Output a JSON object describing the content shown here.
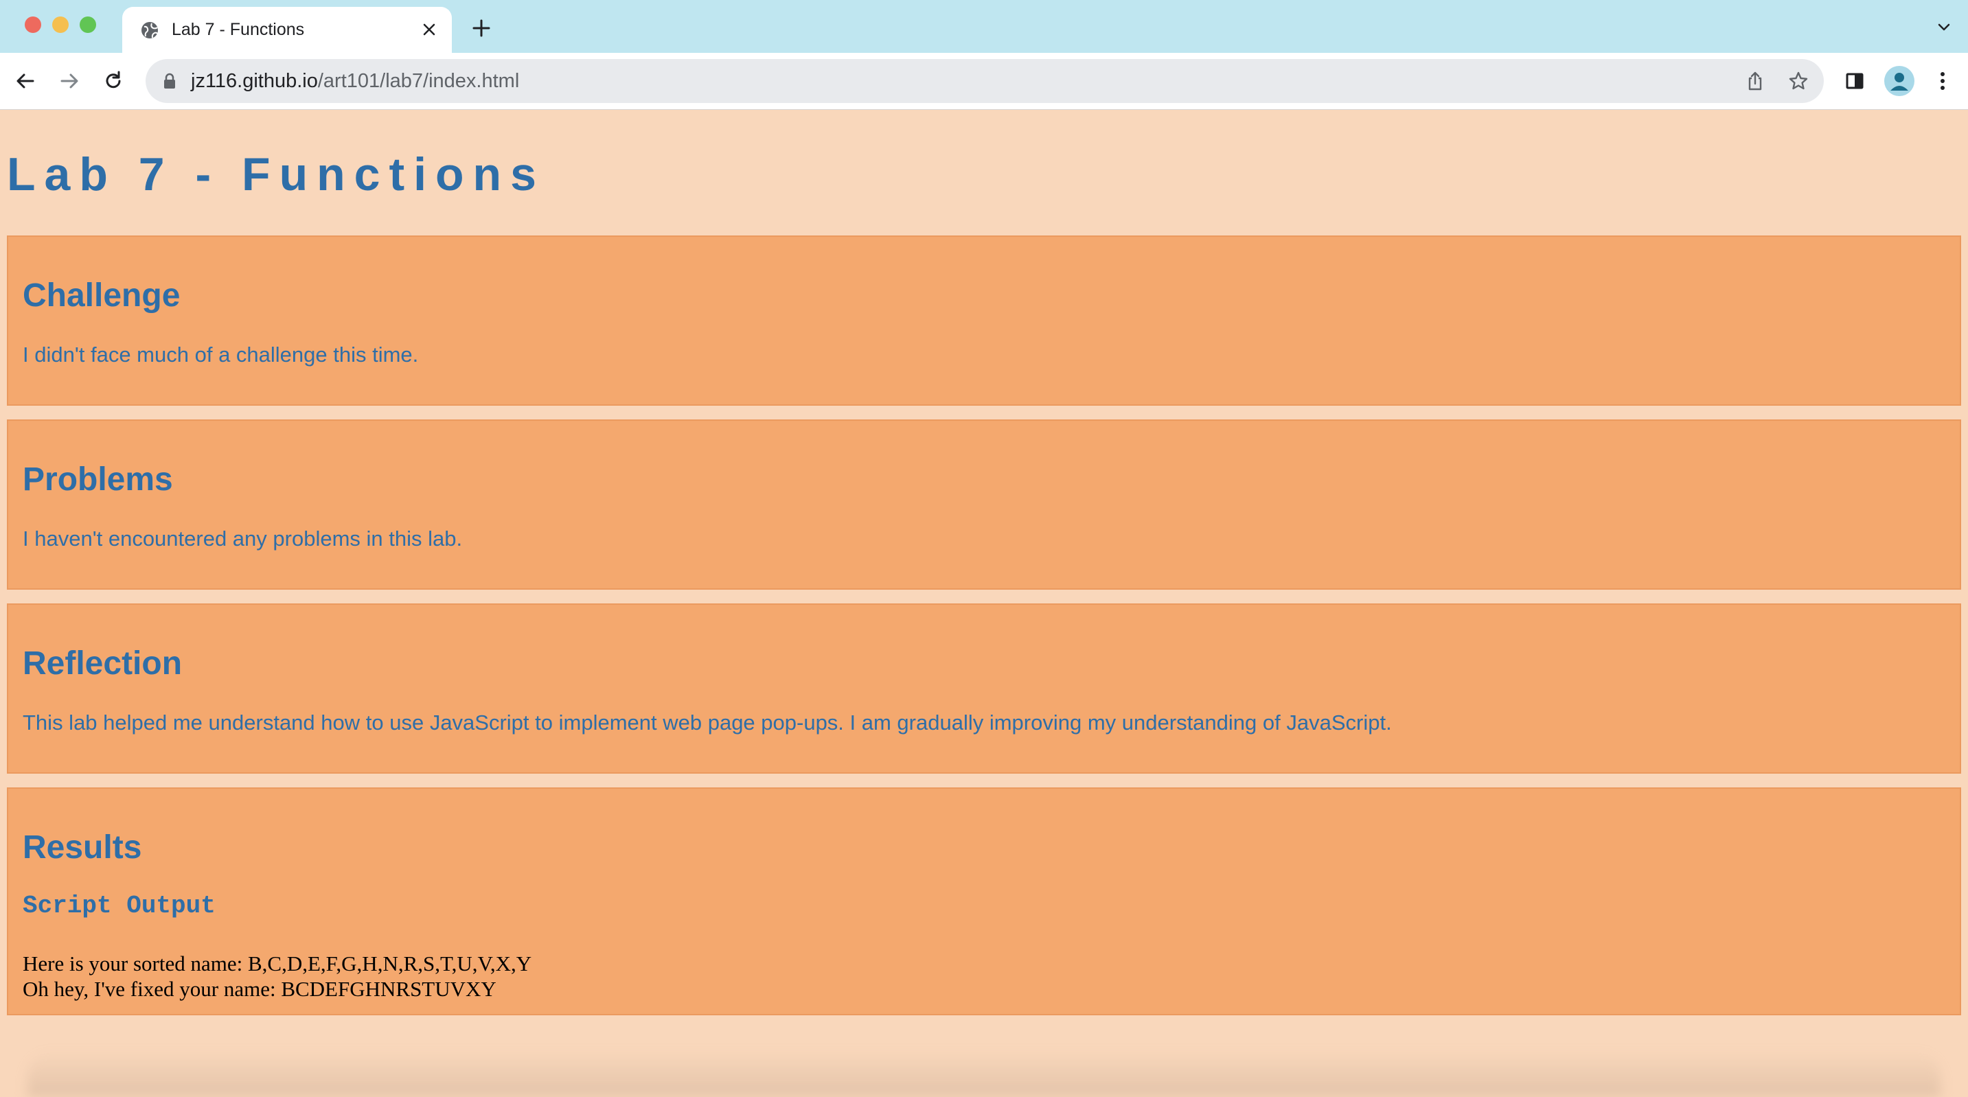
{
  "browser": {
    "tab_title": "Lab 7 - Functions",
    "url_host": "jz116.github.io",
    "url_path": "/art101/lab7/index.html"
  },
  "page": {
    "title": "Lab 7 - Functions",
    "sections": [
      {
        "heading": "Challenge",
        "text": "I didn't face much of a challenge this time."
      },
      {
        "heading": "Problems",
        "text": "I haven't encountered any problems in this lab."
      },
      {
        "heading": "Reflection",
        "text": "This lab helped me understand how to use JavaScript to implement web page pop-ups. I am gradually improving my understanding of JavaScript."
      }
    ],
    "results": {
      "heading": "Results",
      "subheading": "Script Output",
      "lines": [
        "Here is your sorted name: B,C,D,E,F,G,H,N,R,S,T,U,V,X,Y",
        "Oh hey, I've fixed your name: BCDEFGHNRSTUVXY"
      ]
    }
  },
  "colors": {
    "page_bg": "#f9d7bb",
    "section_bg": "#f4a86e",
    "heading_text": "#2e6ea8",
    "tabbar_bg": "#bfe6f0"
  }
}
